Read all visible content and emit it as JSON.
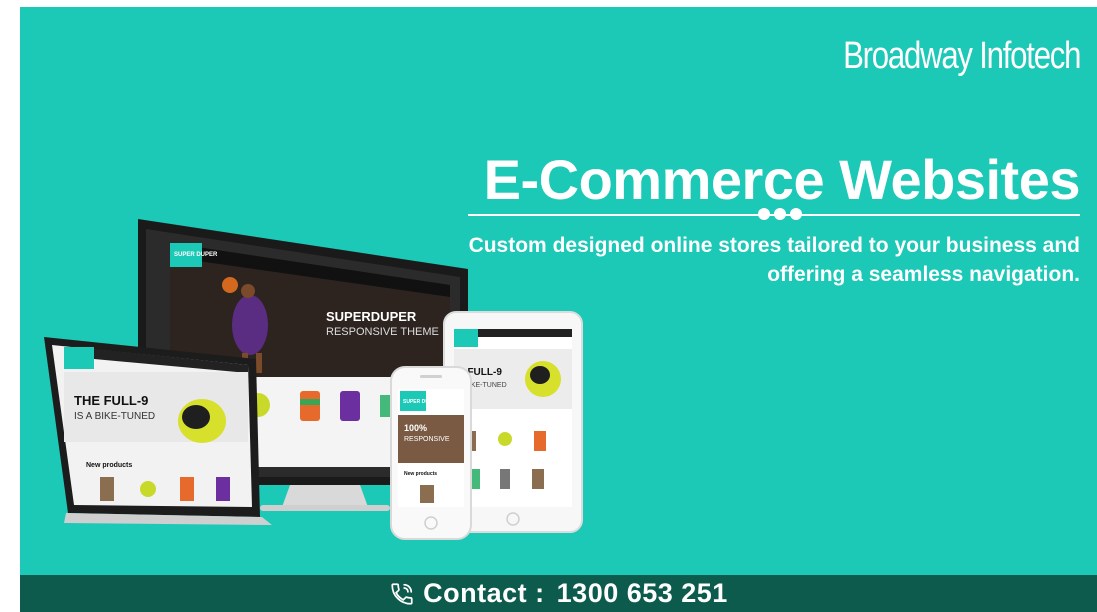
{
  "brand": {
    "name": "Broadway Infotech"
  },
  "hero": {
    "headline": "E-Commerce Websites",
    "tagline": "Custom designed online stores tailored to your business and offering a seamless navigation."
  },
  "mockup": {
    "desktop_title": "SUPERDUPER",
    "desktop_subtitle": "RESPONSIVE THEME",
    "laptop_title": "THE FULL-9",
    "laptop_subtitle": "IS A BIKE-TUNED",
    "laptop_section": "New products",
    "phone_heading": "100%",
    "phone_subheading": "RESPONSIVE",
    "phone_section": "New products",
    "tablet_title": "E FULL-9",
    "tablet_subtitle": "A BIKE-TUNED",
    "logo_text": "SUPER DUPER"
  },
  "contact": {
    "label": "Contact :",
    "phone": "1300 653 251",
    "icon": "phone-icon"
  },
  "colors": {
    "background": "#1cc8b6",
    "contact_bar": "#0c5b4d",
    "text": "#ffffff"
  }
}
